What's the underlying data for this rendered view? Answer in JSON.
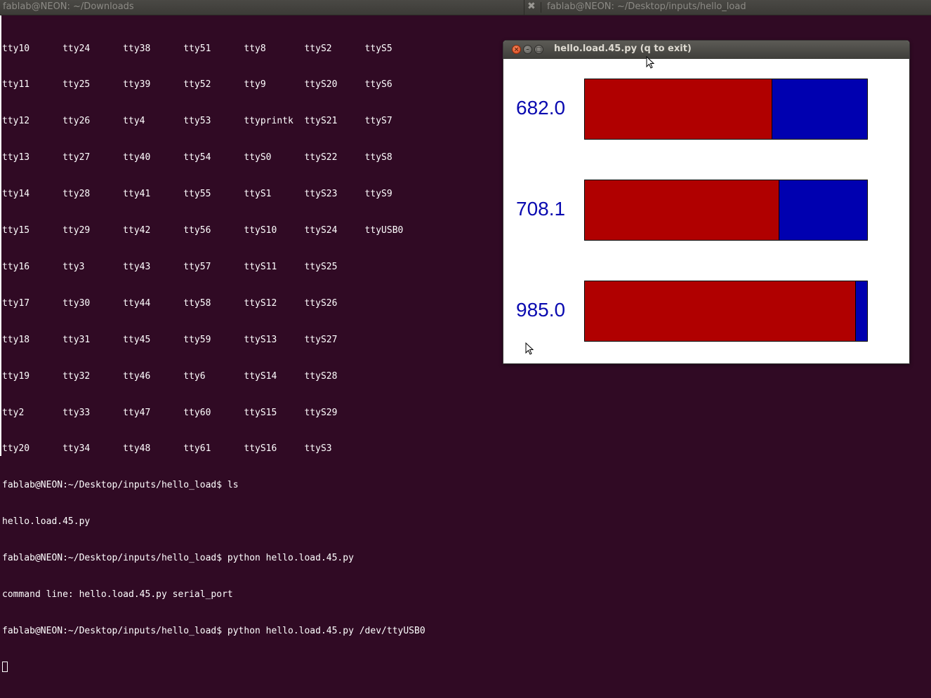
{
  "tabs": {
    "left_title": "fablab@NEON: ~/Downloads",
    "right_title": "fablab@NEON: ~/Desktop/inputs/hello_load",
    "close_glyph": "✖"
  },
  "terminal": {
    "lines": [
      "tty10      tty24      tty38      tty51      tty8       ttyS2      ttyS5",
      "tty11      tty25      tty39      tty52      tty9       ttyS20     ttyS6",
      "tty12      tty26      tty4       tty53      ttyprintk  ttyS21     ttyS7",
      "tty13      tty27      tty40      tty54      ttyS0      ttyS22     ttyS8",
      "tty14      tty28      tty41      tty55      ttyS1      ttyS23     ttyS9",
      "tty15      tty29      tty42      tty56      ttyS10     ttyS24     ttyUSB0",
      "tty16      tty3       tty43      tty57      ttyS11     ttyS25",
      "tty17      tty30      tty44      tty58      ttyS12     ttyS26",
      "tty18      tty31      tty45      tty59      ttyS13     ttyS27",
      "tty19      tty32      tty46      tty6       ttyS14     ttyS28",
      "tty2       tty33      tty47      tty60      ttyS15     ttyS29",
      "tty20      tty34      tty48      tty61      ttyS16     ttyS3",
      "fablab@NEON:~/Desktop/inputs/hello_load$ ls",
      "hello.load.45.py",
      "fablab@NEON:~/Desktop/inputs/hello_load$ python hello.load.45.py",
      "command line: hello.load.45.py serial_port",
      "fablab@NEON:~/Desktop/inputs/hello_load$ python hello.load.45.py /dev/ttyUSB0"
    ]
  },
  "tk_window": {
    "title": "hello.load.45.py (q to exit)",
    "close_glyph": "×",
    "min_glyph": "–",
    "max_glyph": "□",
    "colors": {
      "fill": "#b00000",
      "remainder": "#0000b0",
      "label": "#0a0ab0"
    },
    "bars": [
      {
        "label": "682.0",
        "fraction": 0.664
      },
      {
        "label": "708.1",
        "fraction": 0.69
      },
      {
        "label": "985.0",
        "fraction": 0.96
      }
    ]
  }
}
